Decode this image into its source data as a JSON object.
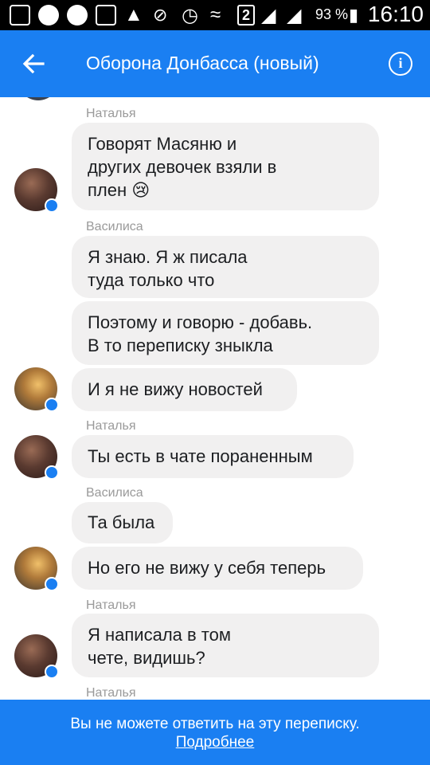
{
  "status_bar": {
    "battery": "93 %",
    "time": "16:10",
    "sim": "2"
  },
  "header": {
    "title": "Оборона Донбасса (новый)",
    "back_icon": "arrow-left-icon",
    "info_icon": "info-icon"
  },
  "messages": [
    {
      "sender": "Наталья"
    },
    {
      "text": "Говорят Масяню и\nдругих девочек взяли в\nплен 😢"
    },
    {
      "sender": "Василиса"
    },
    {
      "text": "Я знаю. Я ж писала\nтуда только что"
    },
    {
      "text": "Поэтому и говорю - добавь.\nВ то переписку зныкла"
    },
    {
      "text": "И я не вижу новостей"
    },
    {
      "sender": "Наталья"
    },
    {
      "text": "Ты есть в чате пораненным"
    },
    {
      "sender": "Василиса"
    },
    {
      "text": "Та была"
    },
    {
      "text": "Но его не вижу у себя теперь"
    },
    {
      "sender": "Наталья"
    },
    {
      "text": "Я написала в том\nчете, видишь?"
    },
    {
      "sender": "Наталья"
    }
  ],
  "footer": {
    "notice": "Вы не можете ответить на эту переписку.",
    "more_link": "Подробнее"
  }
}
